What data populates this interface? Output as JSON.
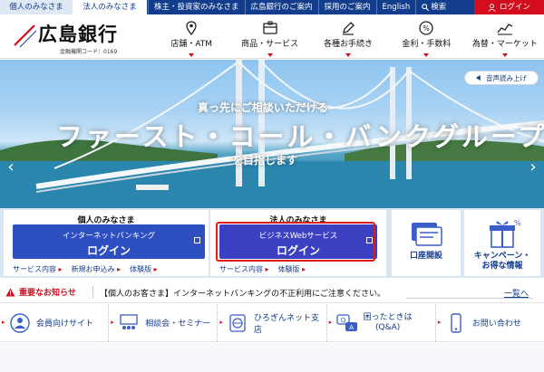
{
  "topbar": {
    "tab_personal": "個人のみなさま",
    "tab_corporate": "法人のみなさま",
    "links": [
      "株主・投資家のみなさま",
      "広島銀行のご案内",
      "採用のご案内",
      "English"
    ],
    "search": "検索",
    "login": "ログイン"
  },
  "header": {
    "logo_text": "広島銀行",
    "logo_sub": "金融機関コード：0169",
    "nav": [
      "店舗・ATM",
      "商品・サービス",
      "各種お手続き",
      "金利・手数料",
      "為替・マーケット"
    ]
  },
  "hero": {
    "voice": "音声読み上げ",
    "subtitle": "真っ先にご相談いただける",
    "title": "ファースト・コール・バンクグループ",
    "aim": "を目指します"
  },
  "panels": {
    "personal": {
      "heading": "個人のみなさま",
      "button_top": "インターネットバンキング",
      "button_main": "ログイン",
      "links": [
        "サービス内容",
        "新規お申込み",
        "体験版"
      ]
    },
    "corporate": {
      "heading": "法人のみなさま",
      "button_top": "ビジネスWebサービス",
      "button_main": "ログイン",
      "links": [
        "サービス内容",
        "体験版"
      ]
    },
    "account": "口座開設",
    "campaign_line1": "キャンペーン・",
    "campaign_line2": "お得な情報"
  },
  "notice": {
    "label": "重要なお知らせ",
    "message": "【個人のお客さま】インターネットバンキングの不正利用にご注意ください。",
    "more": "一覧へ"
  },
  "quick": {
    "items": [
      "会員向けサイト",
      "相談会・セミナー",
      "ひろぎんネット支店",
      "困ったときは",
      "お問い合わせ"
    ],
    "item4_sub": "(Q&A)"
  },
  "colors": {
    "navy": "#123c8c",
    "red": "#d40d1e",
    "button_blue": "#2e4fbf",
    "highlight": "#e01a1a"
  }
}
